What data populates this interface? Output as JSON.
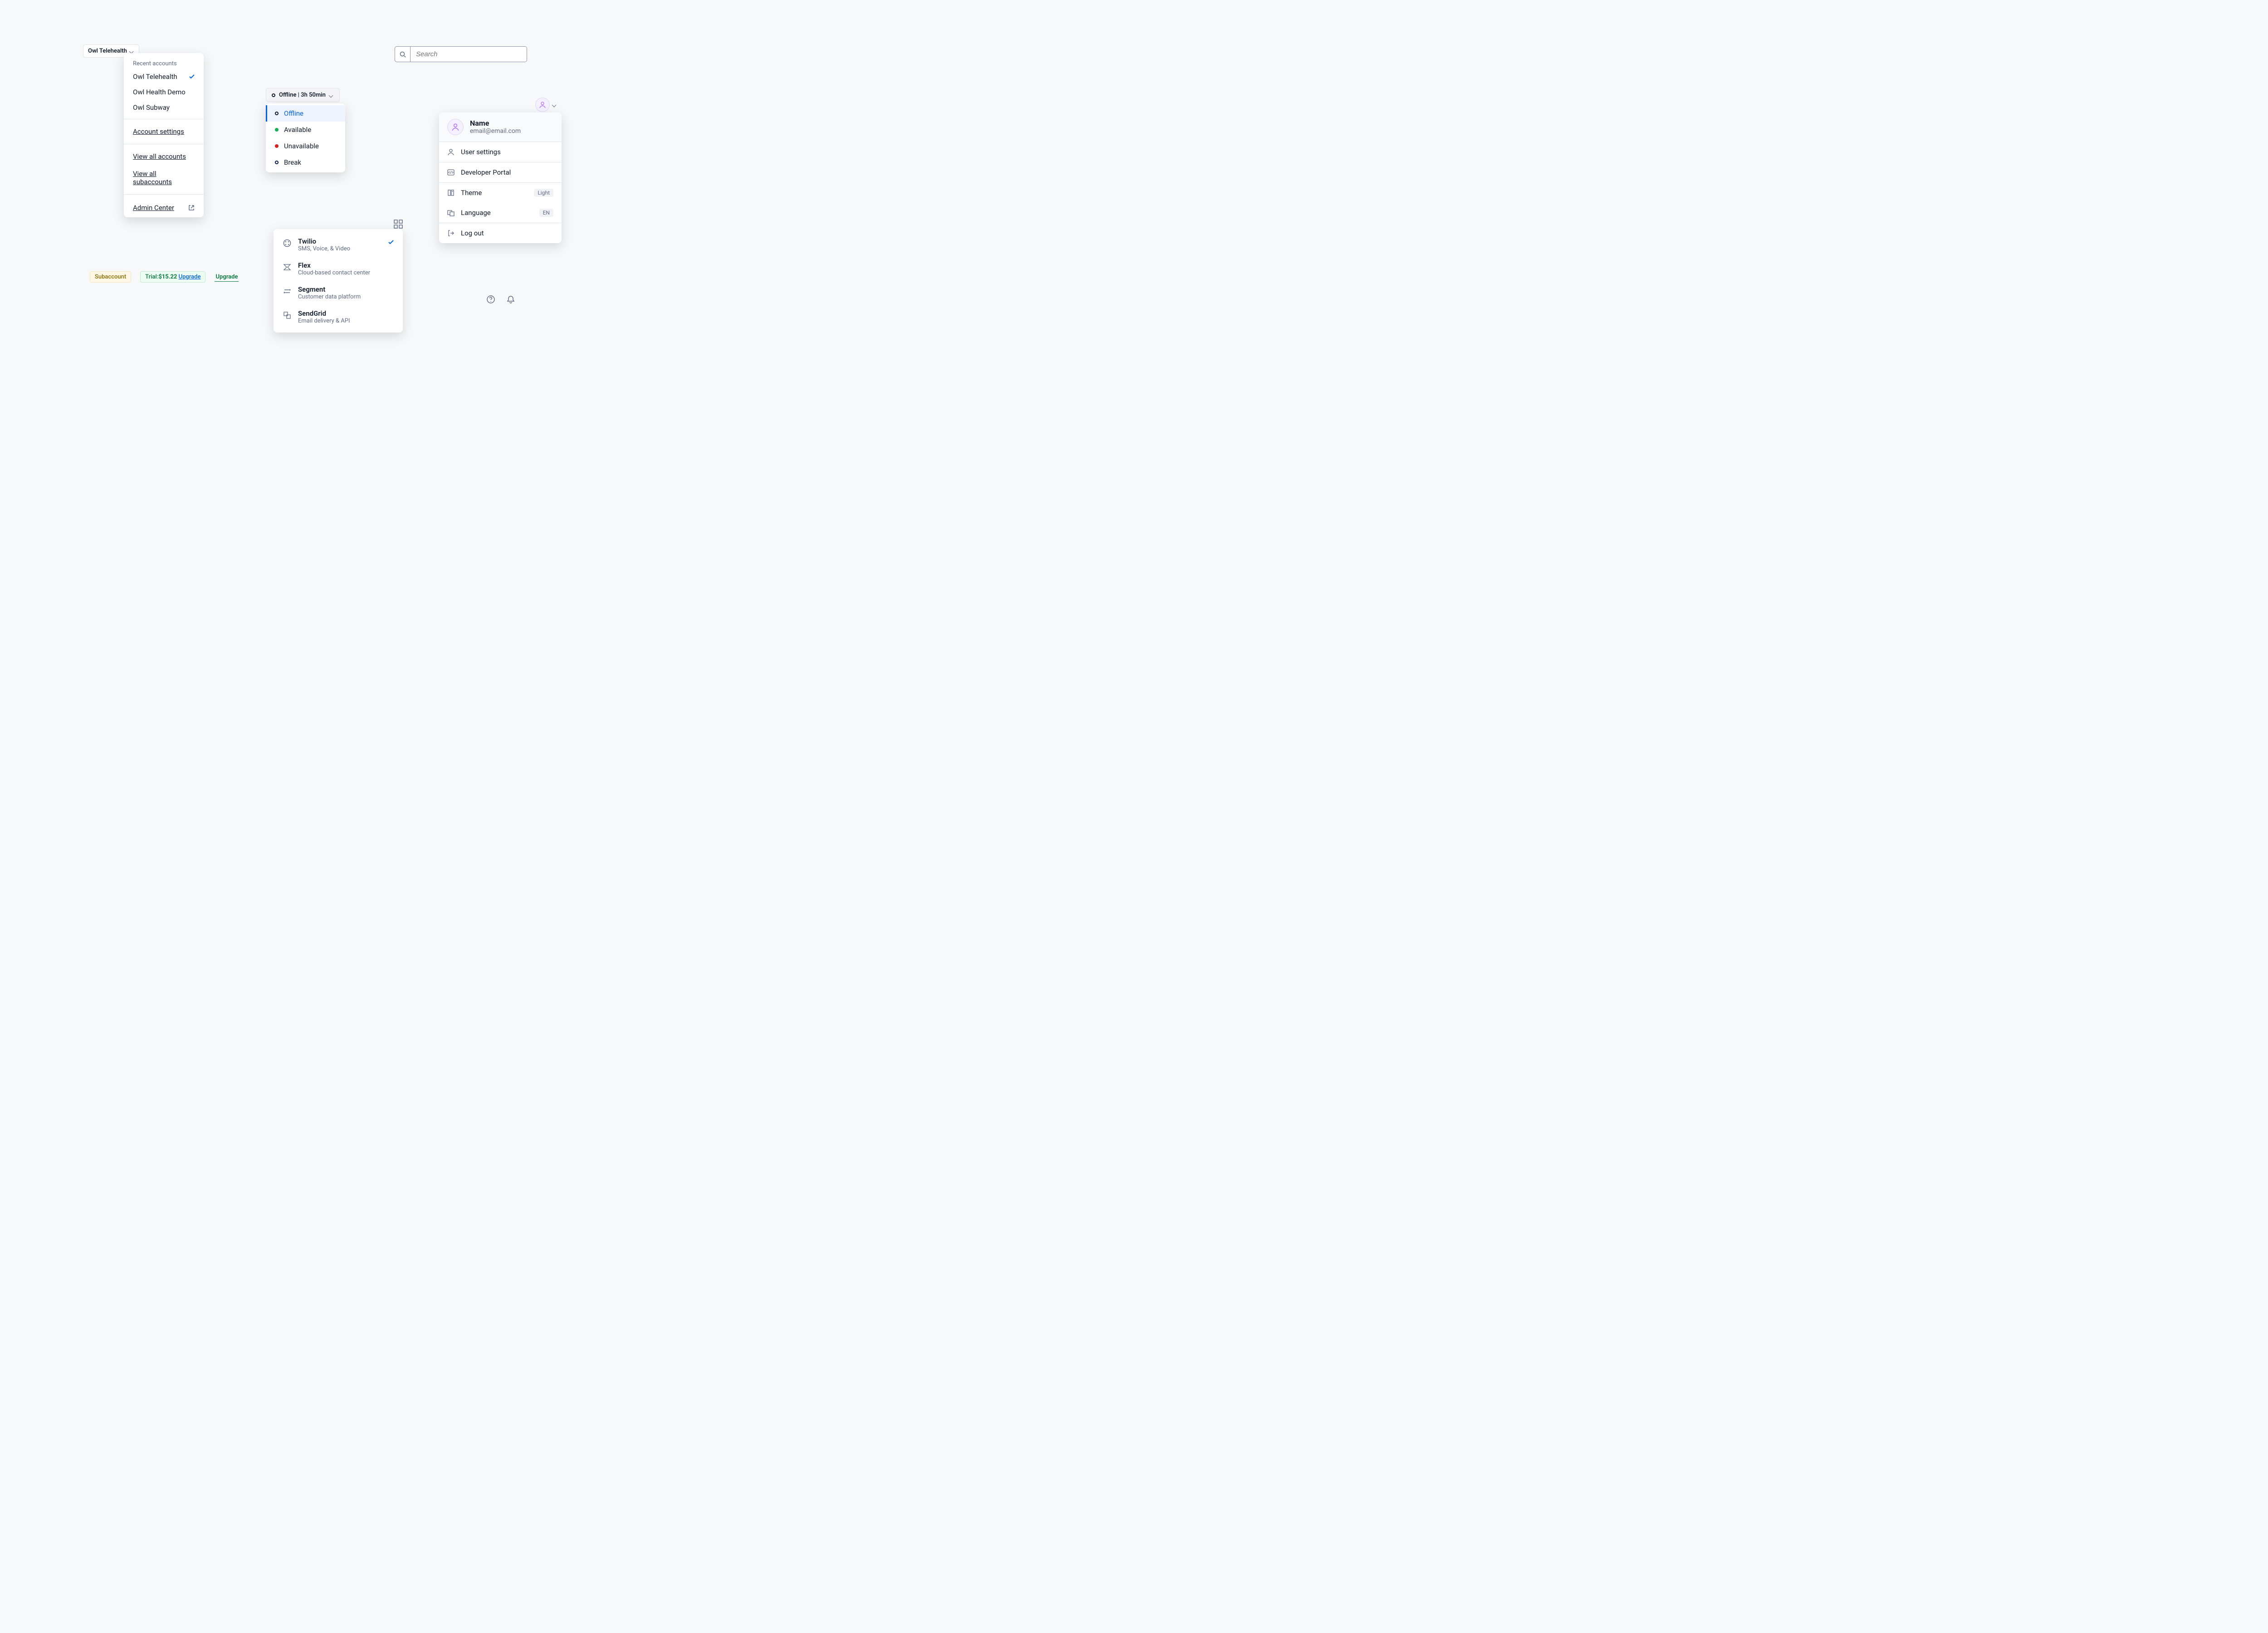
{
  "accountSwitcher": {
    "buttonLabel": "Owl Telehealth",
    "sectionLabel": "Recent accounts",
    "accounts": [
      {
        "name": "Owl Telehealth",
        "selected": true
      },
      {
        "name": "Owl Health Demo",
        "selected": false
      },
      {
        "name": "Owl Subway",
        "selected": false
      }
    ],
    "settingsLink": "Account settings",
    "viewAllAccounts": "View all accounts",
    "viewAllSubaccounts": "View all subaccounts",
    "adminCenter": "Admin Center"
  },
  "search": {
    "placeholder": "Search"
  },
  "status": {
    "buttonLabel": "Offline | 3h 50min",
    "options": [
      {
        "key": "offline",
        "label": "Offline",
        "selected": true
      },
      {
        "key": "available",
        "label": "Available",
        "selected": false
      },
      {
        "key": "unavailable",
        "label": "Unavailable",
        "selected": false
      },
      {
        "key": "break",
        "label": "Break",
        "selected": false
      }
    ]
  },
  "userMenu": {
    "name": "Name",
    "email": "email@email.com",
    "userSettings": "User settings",
    "developerPortal": "Developer Portal",
    "themeLabel": "Theme",
    "themeValue": "Light",
    "languageLabel": "Language",
    "languageValue": "EN",
    "logout": "Log out"
  },
  "products": [
    {
      "name": "Twilio",
      "desc": "SMS, Voice, & Video",
      "selected": true
    },
    {
      "name": "Flex",
      "desc": "Cloud-based contact center",
      "selected": false
    },
    {
      "name": "Segment",
      "desc": "Customer data platform",
      "selected": false
    },
    {
      "name": "SendGrid",
      "desc": "Email delivery & API",
      "selected": false
    }
  ],
  "badges": {
    "subaccount": "Subaccount",
    "trialPrefix": "Trial: ",
    "trialAmount": "$15.22",
    "trialUpgrade": "Upgrade",
    "upgrade": "Upgrade"
  }
}
